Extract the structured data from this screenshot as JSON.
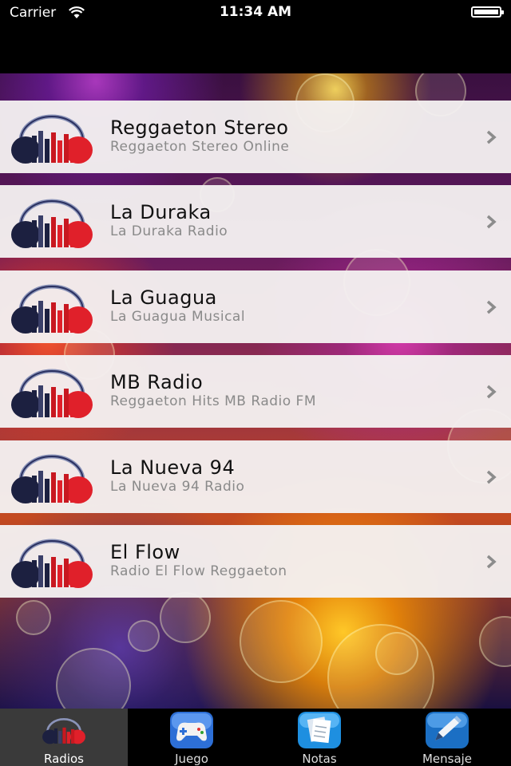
{
  "status_bar": {
    "carrier": "Carrier",
    "time": "11:34 AM"
  },
  "stations": [
    {
      "title": "Reggaeton Stereo",
      "subtitle": "Reggaeton Stereo Online",
      "icon": "headphones-logo-icon"
    },
    {
      "title": "La Duraka",
      "subtitle": "La Duraka Radio",
      "icon": "headphones-logo-icon"
    },
    {
      "title": "La Guagua",
      "subtitle": "La Guagua Musical",
      "icon": "headphones-logo-icon"
    },
    {
      "title": "MB Radio",
      "subtitle": "Reggaeton Hits MB Radio FM",
      "icon": "headphones-logo-icon"
    },
    {
      "title": "La Nueva 94",
      "subtitle": "La Nueva 94 Radio",
      "icon": "headphones-logo-icon"
    },
    {
      "title": "El Flow",
      "subtitle": "Radio El Flow Reggaeton",
      "icon": "headphones-logo-icon"
    }
  ],
  "tab_bar": {
    "tabs": [
      {
        "label": "Radios",
        "icon": "headphones-logo-icon",
        "selected": true
      },
      {
        "label": "Juego",
        "icon": "gamepad-icon",
        "selected": false
      },
      {
        "label": "Notas",
        "icon": "notes-icon",
        "selected": false
      },
      {
        "label": "Mensaje",
        "icon": "pen-message-icon",
        "selected": false
      }
    ]
  },
  "colors": {
    "row_background": "#f4f0f0",
    "title": "#111111",
    "subtitle": "#8a8a8a",
    "chevron": "#8c8c8c",
    "logo_red": "#e0202a",
    "logo_navy": "#1c2040"
  }
}
